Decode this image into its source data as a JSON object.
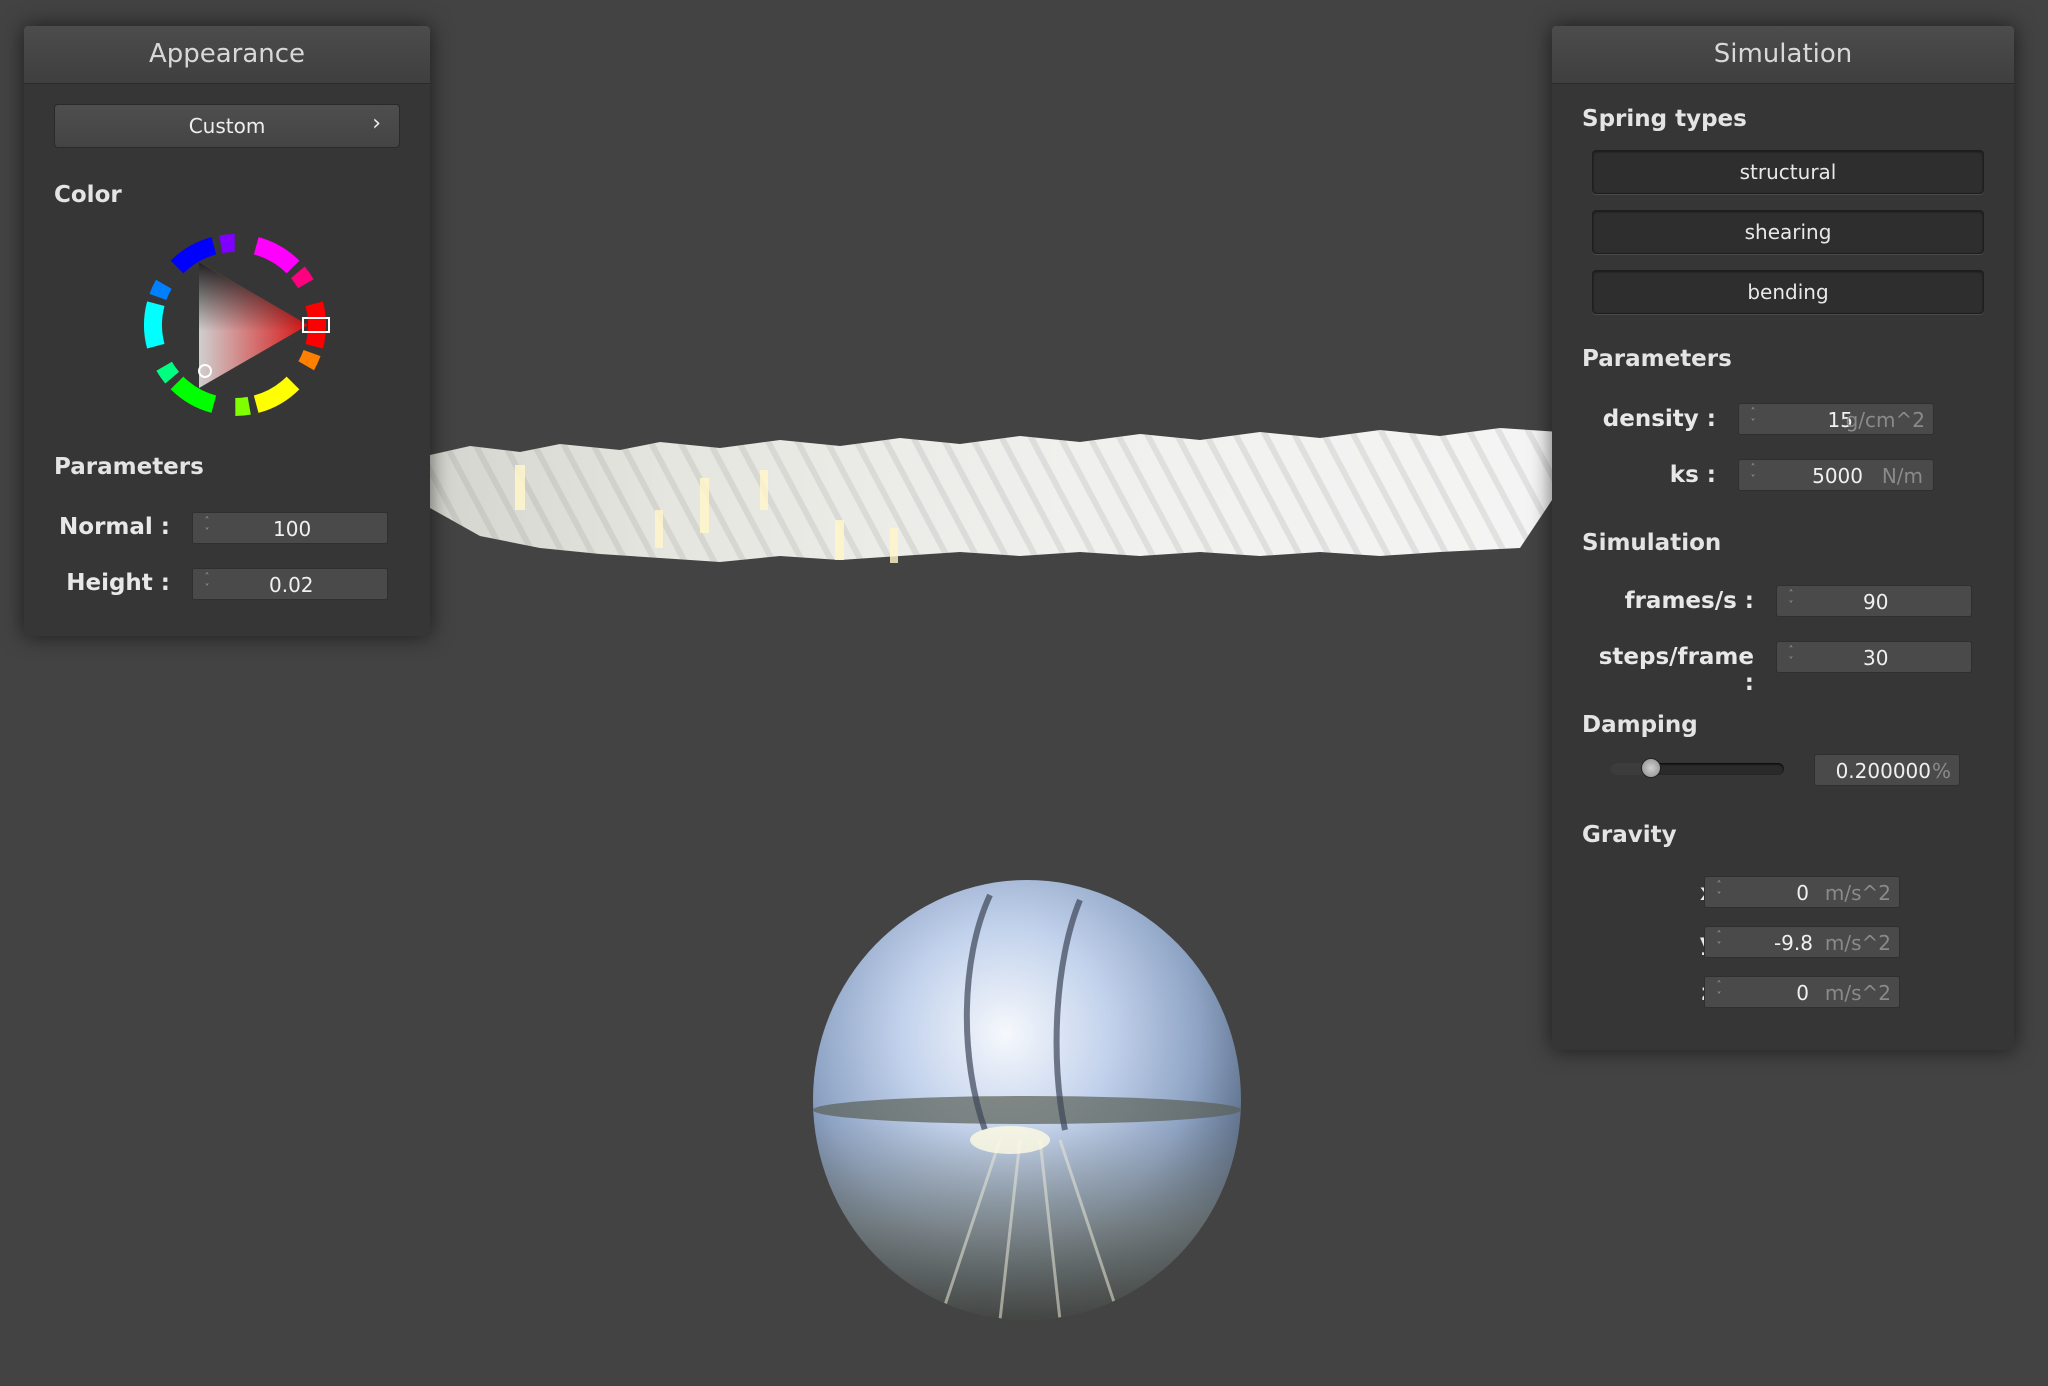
{
  "appearance": {
    "title": "Appearance",
    "preset": "Custom",
    "preset_arrow": "›",
    "color_label": "Color",
    "parameters_label": "Parameters",
    "normal_label": "Normal :",
    "normal_value": "100",
    "height_label": "Height :",
    "height_value": "0.02",
    "selected_color": "#ff0000"
  },
  "simulation": {
    "title": "Simulation",
    "spring_types_label": "Spring types",
    "spring_types": [
      "structural",
      "shearing",
      "bending"
    ],
    "parameters_label": "Parameters",
    "density_label": "density :",
    "density_value": "15",
    "density_unit": "g/cm^2",
    "ks_label": "ks :",
    "ks_value": "5000",
    "ks_unit": "N/m",
    "simulation_label": "Simulation",
    "fps_label": "frames/s :",
    "fps_value": "90",
    "steps_label": "steps/frame :",
    "steps_value": "30",
    "damping_label": "Damping",
    "damping_value": "0.200000",
    "damping_unit": "%",
    "damping_level": 0.2,
    "gravity_label": "Gravity",
    "gx_label": "x :",
    "gx_value": "0",
    "gy_label": "y :",
    "gy_value": "-9.8",
    "gz_label": "z :",
    "gz_value": "0",
    "gravity_unit": "m/s^2"
  }
}
